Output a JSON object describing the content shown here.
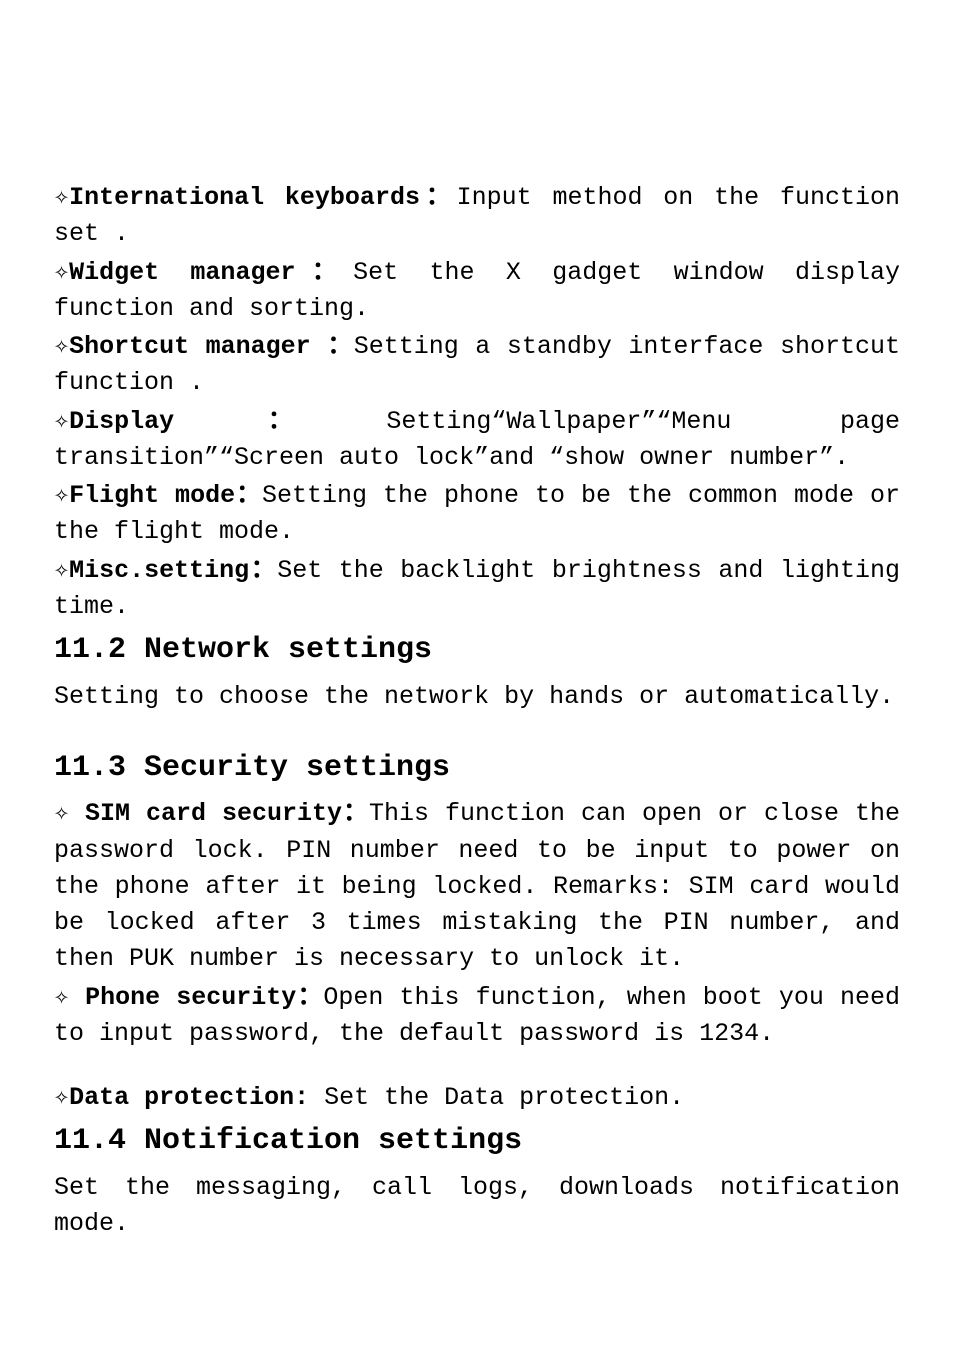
{
  "items": {
    "intlKb": {
      "icon": "✧",
      "label": "International keyboards：",
      "text": "Input method on the function set ."
    },
    "widget": {
      "icon": "✧",
      "label": "Widget manager：",
      "text": "Set the X gadget window display function and sorting."
    },
    "shortcut": {
      "icon": "✧",
      "label": "Shortcut manager ：",
      "text": "Setting a standby interface shortcut function ."
    },
    "display": {
      "icon": "✧",
      "label": "Display：",
      "text": "Setting“Wallpaper”“Menu page transition”“Screen auto lock”and “show owner number”."
    },
    "flight": {
      "icon": "✧",
      "label": "Flight mode：",
      "text": "Setting the phone to be the common mode or the flight mode."
    },
    "misc": {
      "icon": "✧",
      "label": "Misc.setting：",
      "text": "Set the backlight brightness and lighting time."
    },
    "sim": {
      "icon": "✧",
      "label": " SIM card security：",
      "text": "This function can open or close the password lock. PIN number need to be input to power on the phone after it being locked. Remarks: SIM card would be locked after 3 times mistaking the PIN number, and then PUK number is necessary to unlock it."
    },
    "phoneSec": {
      "icon": "✧",
      "label": " Phone security：",
      "text": "Open this function, when boot you need to input password, the default password  is 1234."
    },
    "dataProt": {
      "icon": "✧",
      "label": "Data protection: ",
      "text": "Set the Data protection."
    }
  },
  "sections": {
    "s112": {
      "heading": "11.2 Network settings",
      "body": "Setting to choose the network by hands or automatically."
    },
    "s113": {
      "heading": "11.3 Security settings"
    },
    "s114": {
      "heading": "11.4 Notification settings",
      "body": "Set the messaging, call logs, downloads notification mode."
    }
  }
}
